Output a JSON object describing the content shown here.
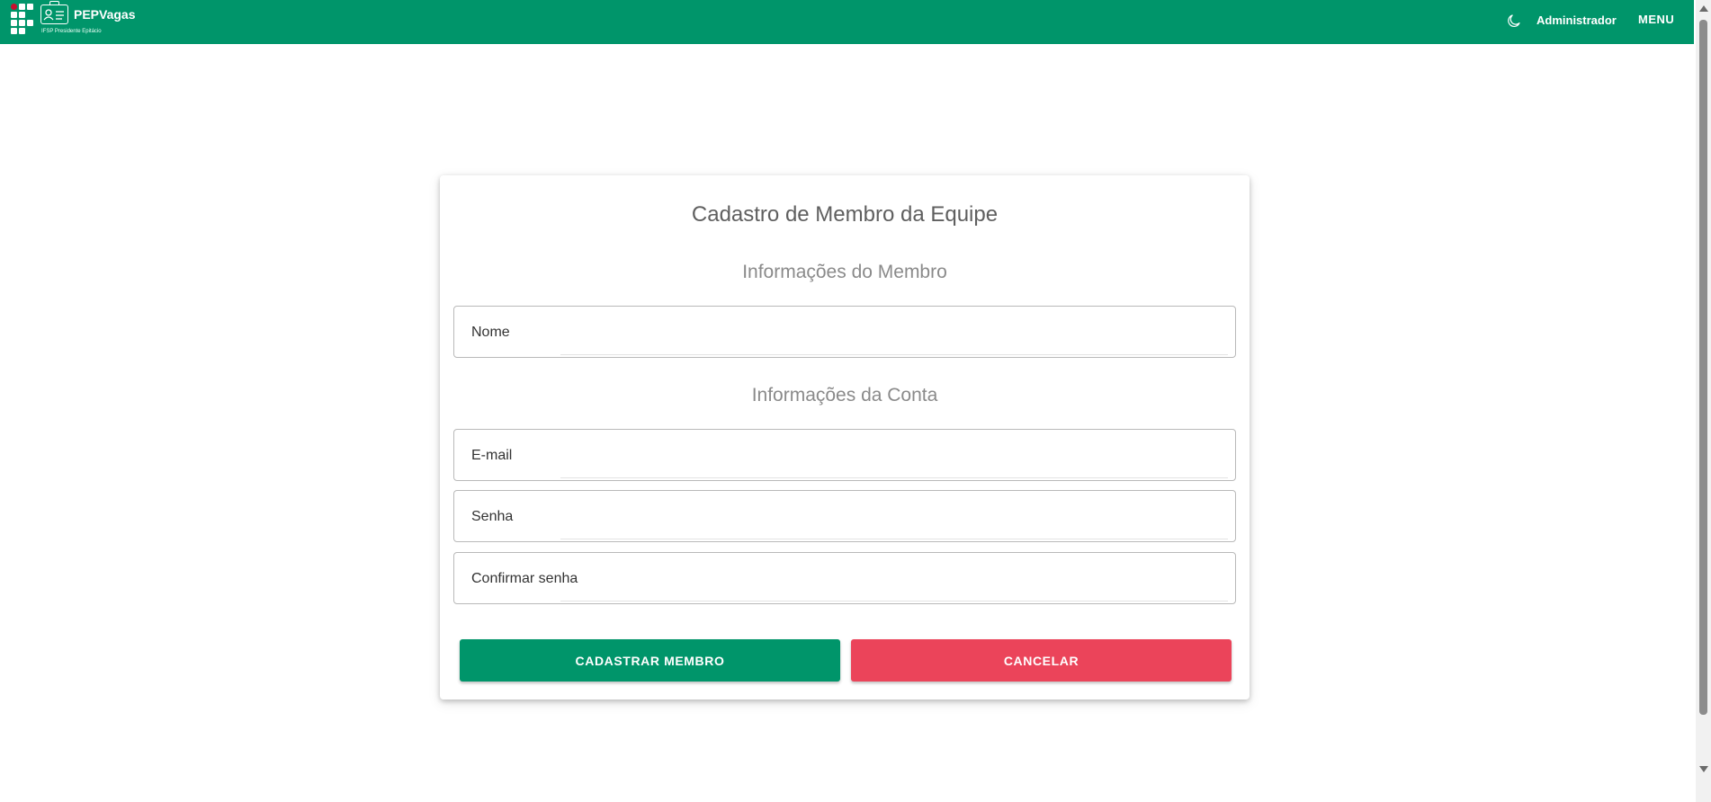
{
  "header": {
    "brand_title": "PEPVagas",
    "brand_subtitle": "IFSP Presidente Epitácio",
    "user_label": "Administrador",
    "menu_label": "MENU",
    "theme_icon": "moon-icon",
    "brand_icon": "id-badge-icon",
    "color": "#00956a"
  },
  "form": {
    "title": "Cadastro de Membro da Equipe",
    "section_member": "Informações do Membro",
    "section_account": "Informações da Conta",
    "name_placeholder": "Nome",
    "email_placeholder": "E-mail",
    "password_placeholder": "Senha",
    "confirm_placeholder": "Confirmar senha",
    "submit_label": "CADASTRAR MEMBRO",
    "cancel_label": "CANCELAR",
    "submit_color": "#00956a",
    "cancel_color": "#eb445a"
  }
}
